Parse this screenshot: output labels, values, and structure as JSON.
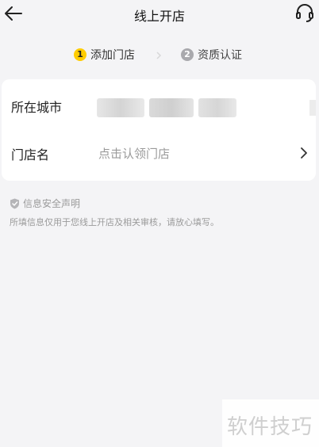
{
  "header": {
    "title": "线上开店",
    "back_icon": "arrow-left-icon",
    "support_icon": "headset-icon"
  },
  "steps": [
    {
      "number": "1",
      "label": "添加门店",
      "state": "active"
    },
    {
      "number": "2",
      "label": "资质认证",
      "state": "inactive"
    }
  ],
  "form": {
    "city_label": "所在城市",
    "city_value_redacted": true,
    "store_label": "门店名",
    "store_placeholder": "点击认领门店"
  },
  "notice": {
    "title": "信息安全声明",
    "text": "所填信息仅用于您线上开店及相关审核，请放心填写。"
  },
  "watermark": "软件技巧",
  "colors": {
    "background": "#f4f4f6",
    "accent": "#ffcc00",
    "inactive_step": "#a9a9ad",
    "muted_text": "#9a9a9a"
  }
}
